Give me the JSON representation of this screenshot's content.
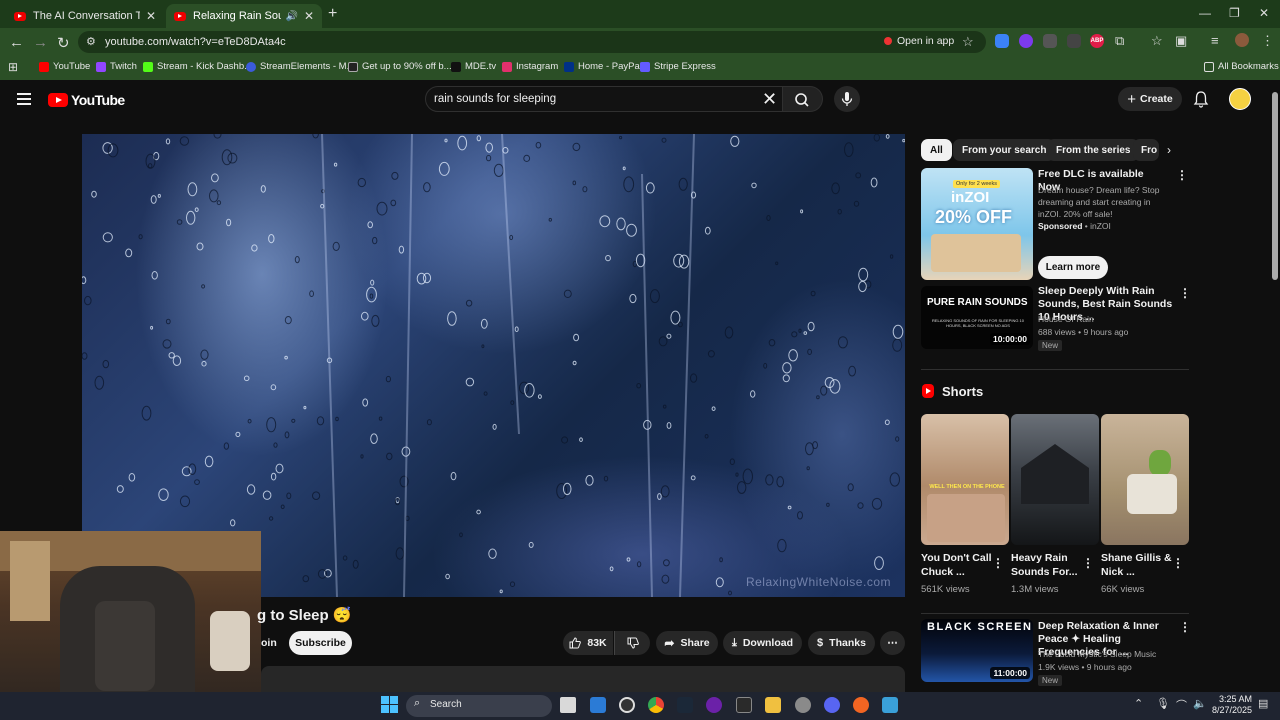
{
  "browser": {
    "tabs": [
      {
        "title": "The AI Conversation That Left M"
      },
      {
        "title": "Relaxing Rain Sounds = Dr"
      }
    ],
    "url": "youtube.com/watch?v=eTeD8DAta4c",
    "open_in_app": "Open in app",
    "bookmarks": [
      "YouTube",
      "Twitch",
      "Stream - Kick Dashb...",
      "StreamElements - M...",
      "Get up to 90% off b...",
      "MDE.tv",
      "Instagram",
      "Home - PayPal",
      "Stripe Express"
    ],
    "all_bookmarks": "All Bookmarks",
    "extension_badge": "ABP"
  },
  "header": {
    "logo": "YouTube",
    "search_query": "rain sounds for sleeping",
    "create_label": "Create"
  },
  "video": {
    "title_partial": "g to Sleep 😴",
    "watermark": "RelaxingWhiteNoise.com",
    "join_partial": "oin",
    "subscribe": "Subscribe",
    "likes": "83K",
    "share": "Share",
    "download": "Download",
    "thanks": "Thanks"
  },
  "sidebar": {
    "chips": [
      "All",
      "From your search",
      "From the series",
      "Fro"
    ],
    "ad": {
      "title": "Free DLC is available Now",
      "desc": "Dream house? Dream life? Stop dreaming and start creating in inZOI. 20% off sale!",
      "sponsored": "Sponsored",
      "advertiser": "inZOI",
      "cta": "Learn more",
      "thumb_line1": "Only for 2 weeks",
      "thumb_line2": "inZOI",
      "thumb_line3": "20% OFF"
    },
    "rec1": {
      "title": "Sleep Deeply With Rain Sounds, Best Rain Sounds 10 Hours ...",
      "channel": "House Of Rain",
      "meta": "688 views • 9 hours ago",
      "badge": "New",
      "duration": "10:00:00",
      "thumb_title": "PURE RAIN SOUNDS",
      "thumb_sub": "RELAXING SOUNDS OF RAIN FOR SLEEPING 10 HOURS, BLACK SCREEN NO ADS"
    },
    "shorts_title": "Shorts",
    "shorts": [
      {
        "title": "You Don't Call Chuck ...",
        "views": "561K views",
        "thumb_text": "WELL THEN ON THE PHONE"
      },
      {
        "title": "Heavy Rain Sounds For...",
        "views": "1.3M views"
      },
      {
        "title": "Shane Gillis & Nick ...",
        "views": "66K views"
      }
    ],
    "rec2": {
      "title": "Deep Relaxation & Inner Peace ✦ Healing Frequencies for ...",
      "channel": "The Lucid Mystic's Sleep Music",
      "meta": "1.9K views • 9 hours ago",
      "badge": "New",
      "duration": "11:00:00",
      "thumb_title": "BLACK SCREEN"
    }
  },
  "taskbar": {
    "search": "Search",
    "time": "3:25 AM",
    "date": "8/27/2025"
  }
}
